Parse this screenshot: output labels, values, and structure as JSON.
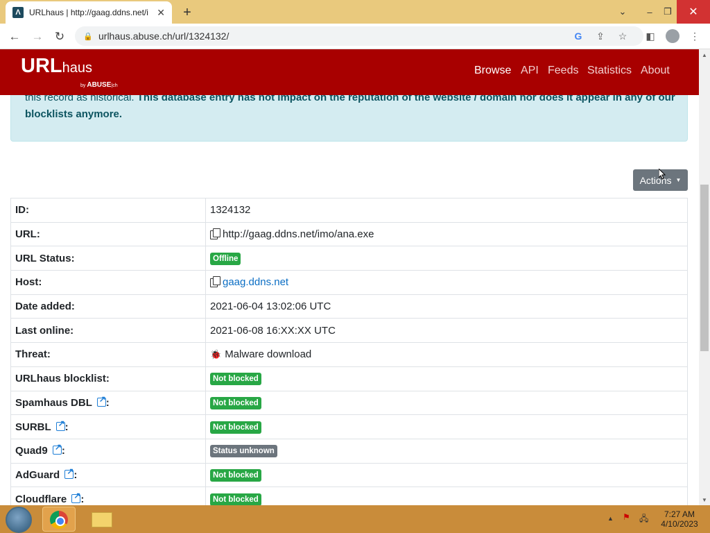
{
  "browser": {
    "tab_title": "URLhaus | http://gaag.ddns.net/i",
    "tab_favicon_glyph": "Λ",
    "new_tab_glyph": "+",
    "address": "urlhaus.abuse.ch/url/1324132/",
    "window_controls": {
      "minimize": "–",
      "maximize": "❐",
      "close": "✕"
    }
  },
  "site": {
    "logo_url": "URL",
    "logo_haus": "haus",
    "logo_by": "by",
    "logo_abuse": "ABUSE",
    "logo_ch": "ch",
    "nav": [
      "Browse",
      "API",
      "Feeds",
      "Statistics",
      "About"
    ]
  },
  "alert": {
    "text_plain": "this record as historical.",
    "text_bold": "This database entry has not impact on the reputation of the website / domain nor does it appear in any of our blocklists anymore."
  },
  "actions_label": "Actions",
  "record": {
    "id_label": "ID:",
    "id": "1324132",
    "url_label": "URL:",
    "url": "http://gaag.ddns.net/imo/ana.exe",
    "status_label": "URL Status:",
    "status": "Offline",
    "host_label": "Host:",
    "host": "gaag.ddns.net",
    "date_added_label": "Date added:",
    "date_added": "2021-06-04 13:02:06 UTC",
    "last_online_label": "Last online:",
    "last_online": "2021-06-08 16:XX:XX UTC",
    "threat_label": "Threat:",
    "threat": "Malware download",
    "urlhaus_label": "URLhaus blocklist:",
    "urlhaus": "Not blocked",
    "spamhaus_label": "Spamhaus DBL",
    "spamhaus": "Not blocked",
    "surbl_label": "SURBL",
    "surbl": "Not blocked",
    "quad9_label": "Quad9",
    "quad9": "Status unknown",
    "adguard_label": "AdGuard",
    "adguard": "Not blocked",
    "cloudflare_label": "Cloudflare",
    "cloudflare": "Not blocked",
    "colon": ":"
  },
  "taskbar": {
    "time": "7:27 AM",
    "date": "4/10/2023"
  },
  "colors": {
    "header": "#a80000",
    "badge_green": "#28a745",
    "badge_grey": "#6c757d",
    "alert_bg": "#d4ecf1"
  }
}
